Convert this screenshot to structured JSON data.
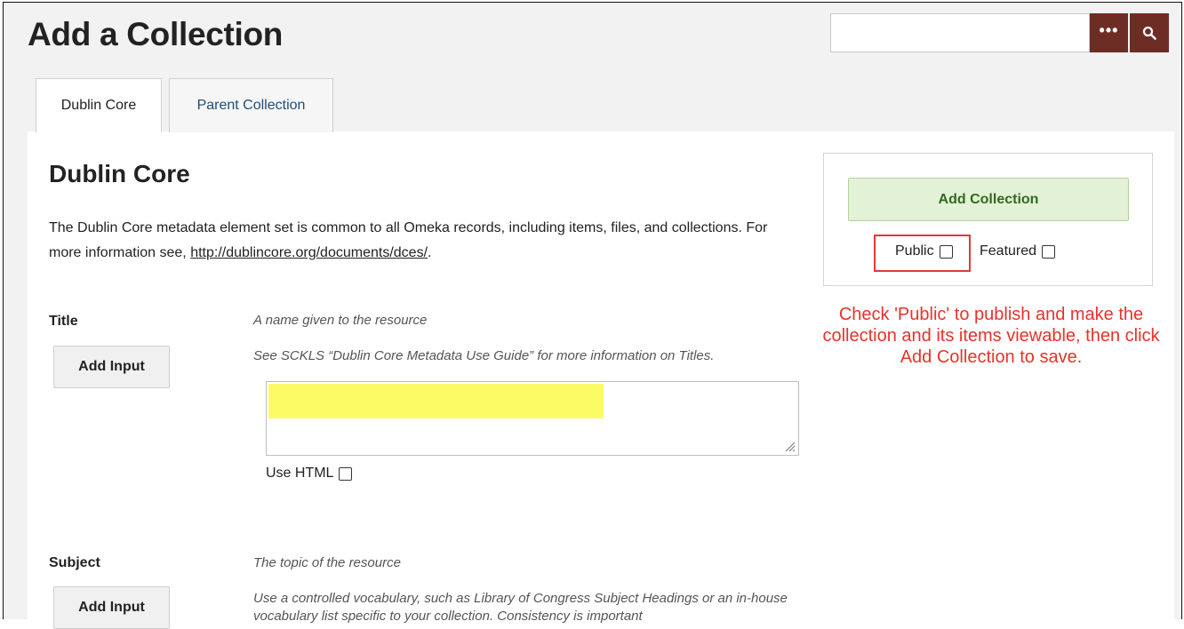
{
  "page_title": "Add a Collection",
  "search": {
    "placeholder": "",
    "value": "",
    "advanced_label": "•••"
  },
  "tabs": [
    {
      "label": "Dublin Core",
      "active": true
    },
    {
      "label": "Parent Collection",
      "active": false
    }
  ],
  "section": {
    "title": "Dublin Core",
    "intro_text": "The Dublin Core metadata element set is common to all Omeka records, including items, files, and collections. For more information see, ",
    "intro_link": "http://dublincore.org/documents/dces/",
    "intro_end": "."
  },
  "fields": {
    "title": {
      "label": "Title",
      "description": "A name given to the resource",
      "guide": "See SCKLS “Dublin Core Metadata Use Guide” for more information on Titles.",
      "add_input_label": "Add Input",
      "use_html_label": "Use HTML"
    },
    "subject": {
      "label": "Subject",
      "description": "The topic of the resource",
      "guide": "Use a controlled vocabulary, such as Library of Congress Subject Headings or an in-house vocabulary list specific to your collection. Consistency is important",
      "add_input_label": "Add Input"
    }
  },
  "save_panel": {
    "add_collection_label": "Add Collection",
    "public_label": "Public",
    "featured_label": "Featured"
  },
  "annotation": "Check 'Public' to publish and make the collection and its items viewable, then click Add Collection to save.",
  "colors": {
    "search_button": "#6e2d24",
    "add_collection_bg": "#e3f1d6",
    "add_collection_text": "#2f6b1f",
    "annotation": "#e5332a",
    "highlight": "#fbfb66",
    "tab_link": "#1f4d7a"
  }
}
